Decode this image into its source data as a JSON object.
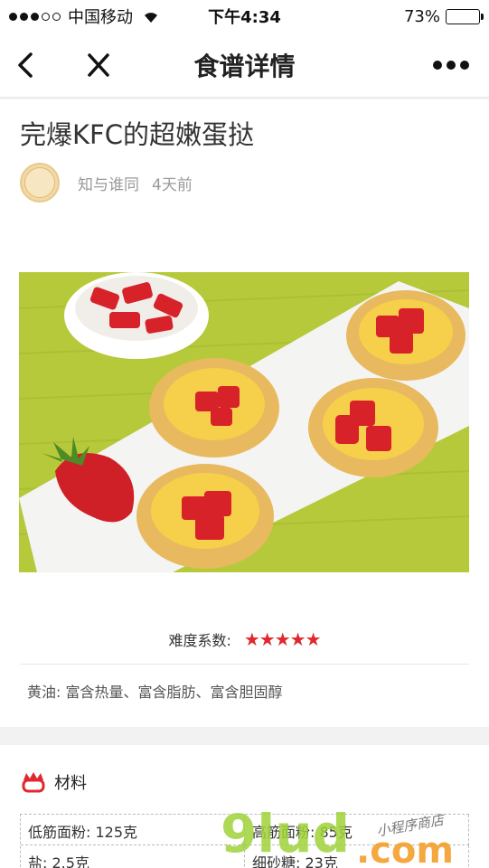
{
  "status_bar": {
    "carrier": "中国移动",
    "time": "下午4:34",
    "battery": "73%",
    "battery_level": 0.73
  },
  "nav": {
    "title": "食谱详情",
    "back_icon": "chevron-left-icon",
    "close_icon": "close-icon",
    "more_icon": "more-dots-icon"
  },
  "recipe": {
    "title": "完爆KFC的超嫩蛋挞",
    "author": "知与谁同",
    "posted": "4天前",
    "difficulty_label": "难度系数:",
    "difficulty_stars": "★★★★★",
    "difficulty_value": 5,
    "note": "黄油: 富含热量、富含脂肪、富含胆固醇"
  },
  "materials": {
    "heading": "材料",
    "rows": [
      [
        "低筋面粉: 125克",
        "高筋面粉: 85克"
      ],
      [
        "盐: 2.5克",
        "细砂糖: 23克"
      ]
    ]
  },
  "watermark": {
    "brand": "9lud.com",
    "handwriting": "小程序商店"
  },
  "colors": {
    "star": "#e0282e",
    "battery": "#f5c518",
    "watermark_green": "#9fd33a",
    "watermark_orange": "#f39a1e"
  }
}
